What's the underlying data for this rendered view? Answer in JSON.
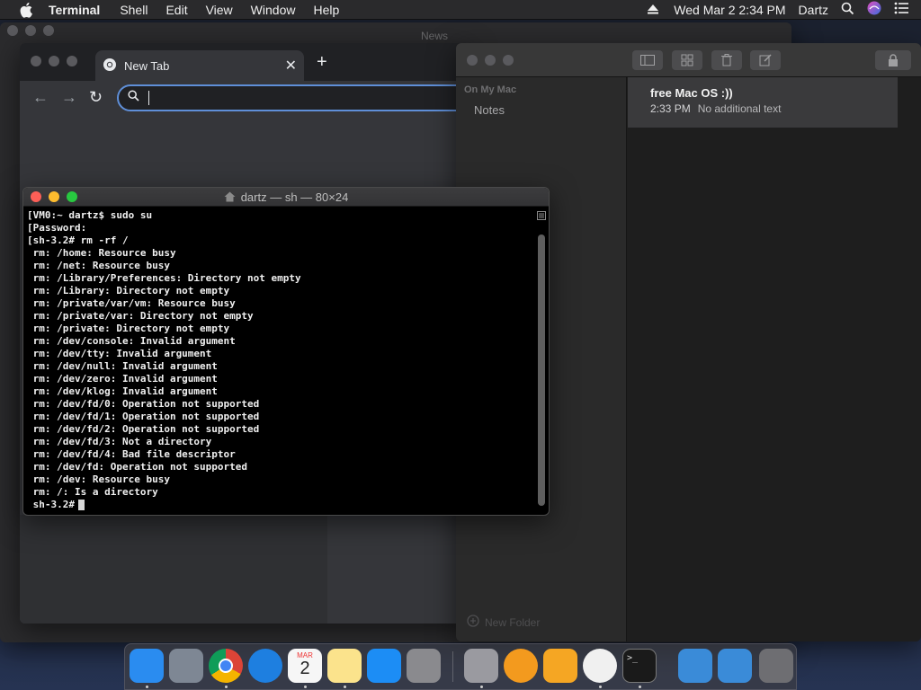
{
  "menubar": {
    "app_name": "Terminal",
    "menus": [
      "Shell",
      "Edit",
      "View",
      "Window",
      "Help"
    ],
    "clock": "Wed Mar 2  2:34 PM",
    "user": "Dartz"
  },
  "news_window": {
    "title": "News"
  },
  "chrome": {
    "tab_title": "New Tab",
    "omnibox_value": ""
  },
  "notes": {
    "section": "On My Mac",
    "folder": "Notes",
    "new_folder": "New Folder",
    "note": {
      "title": "free Mac OS :))",
      "time": "2:33 PM",
      "preview": "No additional text"
    }
  },
  "terminal": {
    "title": "dartz — sh — 80×24",
    "lines": [
      "[VM0:~ dartz$ sudo su",
      "[Password:",
      "[sh-3.2# rm -rf /",
      " rm: /home: Resource busy",
      " rm: /net: Resource busy",
      " rm: /Library/Preferences: Directory not empty",
      " rm: /Library: Directory not empty",
      " rm: /private/var/vm: Resource busy",
      " rm: /private/var: Directory not empty",
      " rm: /private: Directory not empty",
      " rm: /dev/console: Invalid argument",
      " rm: /dev/tty: Invalid argument",
      " rm: /dev/null: Invalid argument",
      " rm: /dev/zero: Invalid argument",
      " rm: /dev/klog: Invalid argument",
      " rm: /dev/fd/0: Operation not supported",
      " rm: /dev/fd/1: Operation not supported",
      " rm: /dev/fd/2: Operation not supported",
      " rm: /dev/fd/3: Not a directory",
      " rm: /dev/fd/4: Bad file descriptor",
      " rm: /dev/fd: Operation not supported",
      " rm: /dev: Resource busy",
      " rm: /: Is a directory"
    ],
    "prompt": " sh-3.2#"
  },
  "dock": {
    "apps": [
      {
        "name": "finder",
        "color": "#2a8cf0"
      },
      {
        "name": "launchpad",
        "color": "#7e8794"
      },
      {
        "name": "chrome",
        "color": "#eeeeee"
      },
      {
        "name": "safari",
        "color": "#1e7fe0"
      },
      {
        "name": "calendar",
        "color": "#f6f6f6"
      },
      {
        "name": "notes",
        "color": "#fbe38c"
      },
      {
        "name": "app-store",
        "color": "#1c8df5"
      },
      {
        "name": "system-preferences",
        "color": "#8a8a8e"
      },
      {
        "name": "preview",
        "color": "#9a9aa0"
      },
      {
        "name": "books",
        "color": "#f39a1e"
      },
      {
        "name": "home",
        "color": "#f5a623"
      },
      {
        "name": "news",
        "color": "#f0f0f0"
      },
      {
        "name": "terminal",
        "color": "#1a1a1a"
      },
      {
        "name": "applications-folder",
        "color": "#3a8bd8"
      },
      {
        "name": "downloads-folder",
        "color": "#3a8bd8"
      },
      {
        "name": "trash",
        "color": "#6e6e72"
      }
    ],
    "calendar_month": "MAR",
    "calendar_day": "2"
  }
}
